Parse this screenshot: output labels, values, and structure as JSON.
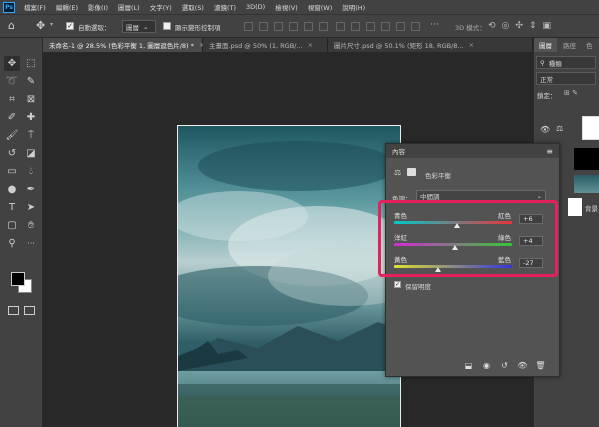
{
  "app": {
    "logo": "Ps"
  },
  "menu": [
    "檔案(F)",
    "編輯(E)",
    "影像(I)",
    "圖層(L)",
    "文字(Y)",
    "選取(S)",
    "濾鏡(T)",
    "3D(D)",
    "檢視(V)",
    "視窗(W)",
    "說明(H)"
  ],
  "options": {
    "auto_select_label": "自動選取：",
    "auto_select_value": "圖層",
    "transform_label": "顯示變形控制項",
    "mode3d_label": "3D 模式："
  },
  "tabs": [
    {
      "label": "未命名-1 @ 28.5% (色彩平衡 1, 圖層遮色片/8) *",
      "close": "×"
    },
    {
      "label": "主畫面.psd @ 50% (1, RGB/...",
      "close": "×"
    },
    {
      "label": "圖片尺寸.psd @ 50.1% (矩形 18, RGB/8...",
      "close": "×"
    }
  ],
  "layers_panel": {
    "tabs": [
      "圖層",
      "路徑",
      "色"
    ],
    "filter_value": "種類",
    "blend_mode": "正常",
    "lock_label": "鎖定：",
    "bottom_layer_name": "背景"
  },
  "properties": {
    "panel_title": "內容",
    "adjustment_name": "色彩平衡",
    "tone_label": "色調：",
    "tone_value": "中間調",
    "sliders": [
      {
        "left": "青色",
        "right": "紅色",
        "value": "+6",
        "fraction": 0.53,
        "colors": [
          "#00c8c8",
          "#e8343c"
        ]
      },
      {
        "left": "洋紅",
        "right": "綠色",
        "value": "+4",
        "fraction": 0.52,
        "colors": [
          "#d42ad4",
          "#34c834"
        ]
      },
      {
        "left": "黃色",
        "right": "藍色",
        "value": "-27",
        "fraction": 0.37,
        "colors": [
          "#e0e030",
          "#3434e0"
        ]
      }
    ],
    "preserve_label": "保留明度"
  },
  "colors": {
    "highlight": "#e4215c",
    "panel_bg": "#535353",
    "app_bg": "#424242"
  }
}
